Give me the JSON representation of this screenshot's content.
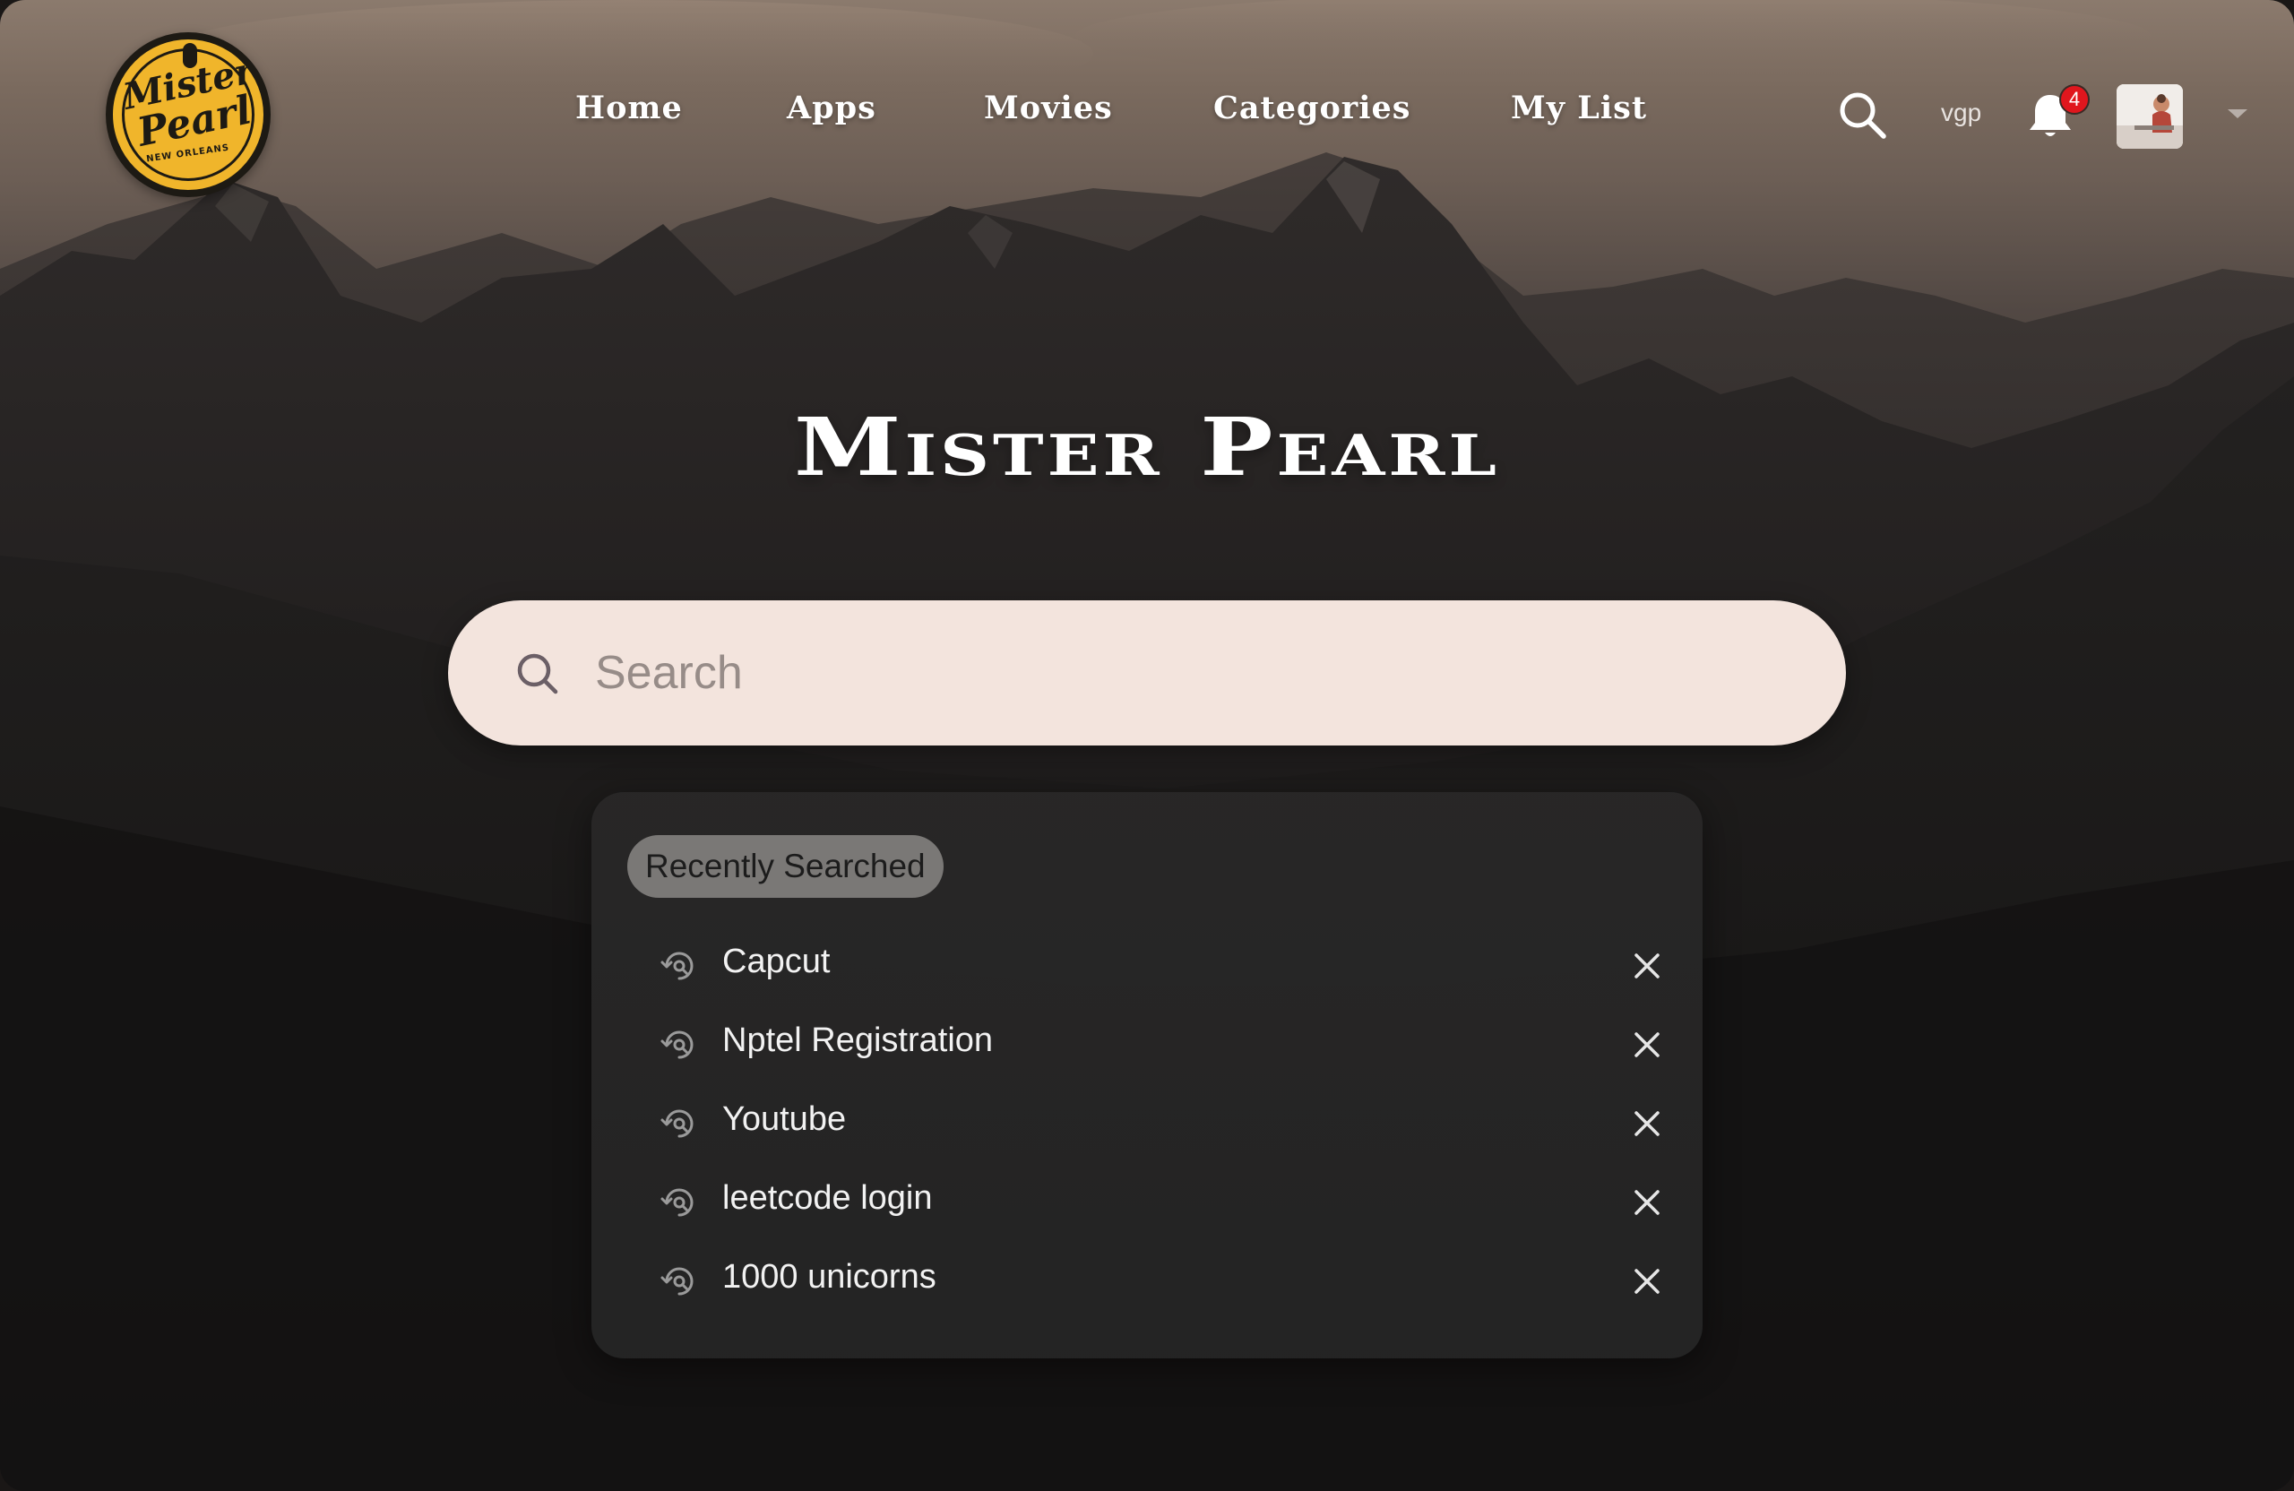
{
  "logo": {
    "line1": "Mister",
    "line2": "Pearl",
    "sub": "NEW ORLEANS",
    "icon": "microphone-icon"
  },
  "nav": {
    "items": [
      {
        "label": "Home"
      },
      {
        "label": "Apps"
      },
      {
        "label": "Movies"
      },
      {
        "label": "Categories"
      },
      {
        "label": "My List"
      }
    ],
    "search_icon": "search-icon",
    "username": "vgp",
    "notifications": {
      "icon": "bell-icon",
      "count": "4"
    },
    "avatar_menu_icon": "caret-down-icon"
  },
  "hero": {
    "title": "Mister Pearl"
  },
  "search": {
    "placeholder": "Search",
    "value": "",
    "icon": "search-icon"
  },
  "recent": {
    "heading": "Recently Searched",
    "item_icon": "history-icon",
    "remove_icon": "close-icon",
    "items": [
      {
        "label": "Capcut"
      },
      {
        "label": "Nptel Registration"
      },
      {
        "label": "Youtube"
      },
      {
        "label": "leetcode login"
      },
      {
        "label": "1000 unicorns"
      }
    ]
  },
  "colors": {
    "logo_yellow": "#f0b52b",
    "search_bg": "#f3e4dd",
    "panel_bg": "#282727",
    "chip_bg": "#7a7876",
    "badge_red": "#e0161d",
    "text_white": "#ffffff"
  }
}
